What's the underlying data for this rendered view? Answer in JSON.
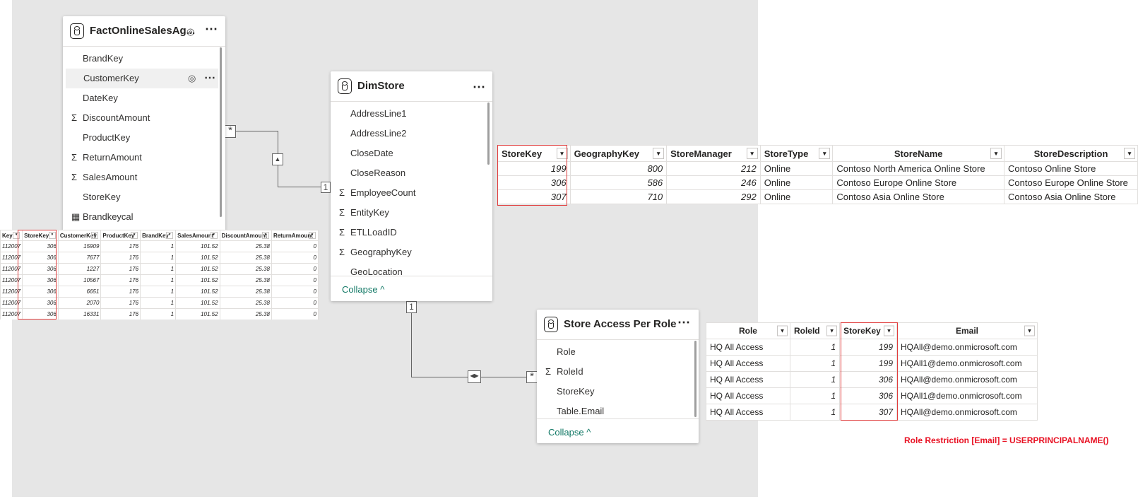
{
  "canvas": {
    "background": "#e6e6e6"
  },
  "fact_card": {
    "title": "FactOnlineSalesAg...",
    "fields": [
      {
        "name": "BrandKey",
        "sigma": false,
        "calc": false
      },
      {
        "name": "CustomerKey",
        "sigma": false,
        "calc": false,
        "highlighted": true
      },
      {
        "name": "DateKey",
        "sigma": false,
        "calc": false
      },
      {
        "name": "DiscountAmount",
        "sigma": true,
        "calc": false
      },
      {
        "name": "ProductKey",
        "sigma": false,
        "calc": false
      },
      {
        "name": "ReturnAmount",
        "sigma": true,
        "calc": false
      },
      {
        "name": "SalesAmount",
        "sigma": true,
        "calc": false
      },
      {
        "name": "StoreKey",
        "sigma": false,
        "calc": false
      },
      {
        "name": "Brandkeycal",
        "sigma": false,
        "calc": true
      }
    ]
  },
  "dimstore_card": {
    "title": "DimStore",
    "fields": [
      {
        "name": "AddressLine1",
        "sigma": false
      },
      {
        "name": "AddressLine2",
        "sigma": false
      },
      {
        "name": "CloseDate",
        "sigma": false
      },
      {
        "name": "CloseReason",
        "sigma": false
      },
      {
        "name": "EmployeeCount",
        "sigma": true
      },
      {
        "name": "EntityKey",
        "sigma": true
      },
      {
        "name": "ETLLoadID",
        "sigma": true
      },
      {
        "name": "GeographyKey",
        "sigma": true
      },
      {
        "name": "GeoLocation",
        "sigma": false
      }
    ],
    "collapse_label": "Collapse ^"
  },
  "role_card": {
    "title": "Store Access Per Role",
    "fields": [
      {
        "name": "Role",
        "sigma": false
      },
      {
        "name": "RoleId",
        "sigma": true
      },
      {
        "name": "StoreKey",
        "sigma": false
      },
      {
        "name": "Table.Email",
        "sigma": false
      }
    ],
    "collapse_label": "Collapse ^"
  },
  "relationships": {
    "fact_many": "*",
    "dim_one_a": "1",
    "dim_one_b": "1",
    "role_many": "*",
    "filter_single": "▲",
    "filter_both": "◀▶"
  },
  "dimstore_table": {
    "columns": [
      "StoreKey",
      "GeographyKey",
      "StoreManager",
      "StoreType",
      "StoreName",
      "StoreDescription"
    ],
    "rows": [
      [
        "199",
        "800",
        "212",
        "Online",
        "Contoso North America Online Store",
        "Contoso Online Store"
      ],
      [
        "306",
        "586",
        "246",
        "Online",
        "Contoso Europe Online Store",
        "Contoso Europe Online Store"
      ],
      [
        "307",
        "710",
        "292",
        "Online",
        "Contoso Asia Online Store",
        "Contoso Asia Online Store"
      ]
    ]
  },
  "fact_table": {
    "columns": [
      "Key",
      "StoreKey",
      "CustomerKey",
      "ProductKey",
      "BrandKey",
      "SalesAmount",
      "DiscountAmount",
      "ReturnAmount"
    ],
    "rows": [
      [
        "112007",
        "306",
        "15909",
        "176",
        "1",
        "101.52",
        "25.38",
        "0"
      ],
      [
        "112007",
        "306",
        "7677",
        "176",
        "1",
        "101.52",
        "25.38",
        "0"
      ],
      [
        "112007",
        "306",
        "1227",
        "176",
        "1",
        "101.52",
        "25.38",
        "0"
      ],
      [
        "112007",
        "306",
        "10567",
        "176",
        "1",
        "101.52",
        "25.38",
        "0"
      ],
      [
        "112007",
        "306",
        "6651",
        "176",
        "1",
        "101.52",
        "25.38",
        "0"
      ],
      [
        "112007",
        "306",
        "2070",
        "176",
        "1",
        "101.52",
        "25.38",
        "0"
      ],
      [
        "112007",
        "306",
        "16331",
        "176",
        "1",
        "101.52",
        "25.38",
        "0"
      ]
    ]
  },
  "role_table": {
    "columns": [
      "Role",
      "RoleId",
      "StoreKey",
      "Email"
    ],
    "rows": [
      [
        "HQ All Access",
        "1",
        "199",
        "HQAll@demo.onmicrosoft.com"
      ],
      [
        "HQ All Access",
        "1",
        "199",
        "HQAll1@demo.onmicrosoft.com"
      ],
      [
        "HQ All Access",
        "1",
        "306",
        "HQAll@demo.onmicrosoft.com"
      ],
      [
        "HQ All Access",
        "1",
        "306",
        "HQAll1@demo.onmicrosoft.com"
      ],
      [
        "HQ All Access",
        "1",
        "307",
        "HQAll@demo.onmicrosoft.com"
      ]
    ]
  },
  "note": {
    "text": "Role Restriction [Email] = USERPRINCIPALNAME()",
    "color": "#e81123"
  }
}
